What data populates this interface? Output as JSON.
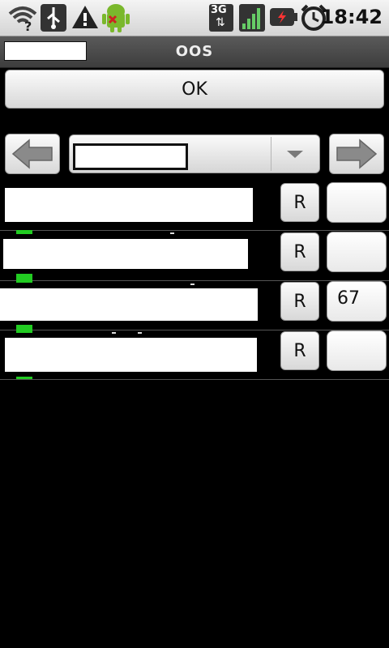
{
  "status_bar": {
    "time": "18:42",
    "network_type": "3G",
    "icons": [
      "wifi-question-icon",
      "usb-icon",
      "warning-icon",
      "android-debug-icon",
      "signal-icon",
      "battery-charging-icon",
      "alarm-clock-icon"
    ]
  },
  "app_bar": {
    "title": "OOS"
  },
  "ok_button": {
    "label": "OK"
  },
  "nav": {
    "prev_icon": "arrow-left-icon",
    "next_icon": "arrow-right-icon",
    "spinner_caret_icon": "chevron-down-icon"
  },
  "rows": [
    {
      "button_label": "R",
      "value": ""
    },
    {
      "button_label": "R",
      "value": ""
    },
    {
      "button_label": "R",
      "value": "67"
    },
    {
      "button_label": "R",
      "value": ""
    }
  ],
  "colors": {
    "accent_green": "#22cc22",
    "background": "#000000"
  }
}
